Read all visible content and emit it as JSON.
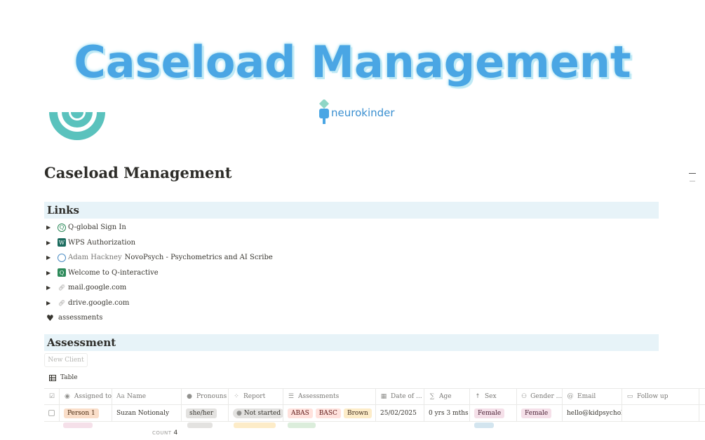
{
  "banner": {
    "title": "Caseload Management",
    "logo_text": "neurokinder"
  },
  "page_title": "Caseload Management",
  "links_section": {
    "heading": "Links",
    "items": [
      {
        "label": "Q-global Sign In",
        "icon": "q-global-icon",
        "prefix": ""
      },
      {
        "label": "WPS Authorization",
        "icon": "wps-icon",
        "prefix": ""
      },
      {
        "label": "NovoPsych - Psychometrics and AI Scribe",
        "icon": "novopsych-icon",
        "prefix": "Adam Hackney"
      },
      {
        "label": "Welcome to Q-interactive",
        "icon": "q-interactive-icon",
        "prefix": ""
      },
      {
        "label": "mail.google.com",
        "icon": "link-icon",
        "prefix": ""
      },
      {
        "label": "drive.google.com",
        "icon": "link-icon",
        "prefix": ""
      }
    ],
    "assessments_label": "assessments"
  },
  "assessment_section": {
    "heading": "Assessment",
    "new_button": "New Client",
    "view_tab": "Table",
    "columns": {
      "assigned": "Assigned to",
      "name": "Name",
      "pronouns": "Pronouns",
      "report": "Report",
      "assessments": "Assessments",
      "date": "Date of ...",
      "age": "Age",
      "sex": "Sex",
      "gender": "Gender ...",
      "email": "Email",
      "follow": "Follow up"
    },
    "row1": {
      "assigned": "Person 1",
      "name": "Suzan Notionaly",
      "pronouns": "she/her",
      "report": "Not started",
      "assessments": [
        "ABAS",
        "BASC",
        "Brown"
      ],
      "date": "25/02/2025",
      "age": "0 yrs 3 mths",
      "sex": "Female",
      "gender": "Female",
      "email": "hello@kidpsycholog"
    },
    "count_label": "COUNT",
    "count_value": "4"
  },
  "colors": {
    "banner_title": "#4aa6e4",
    "section_bg": "#e7f3f8",
    "tag_person": "#fadec9",
    "tag_gray": "#e3e2e0",
    "tag_abas": "#ffe2dd",
    "tag_basc": "#ffe2dd",
    "tag_brown": "#fdecc8",
    "tag_female": "#f5e0e9"
  }
}
